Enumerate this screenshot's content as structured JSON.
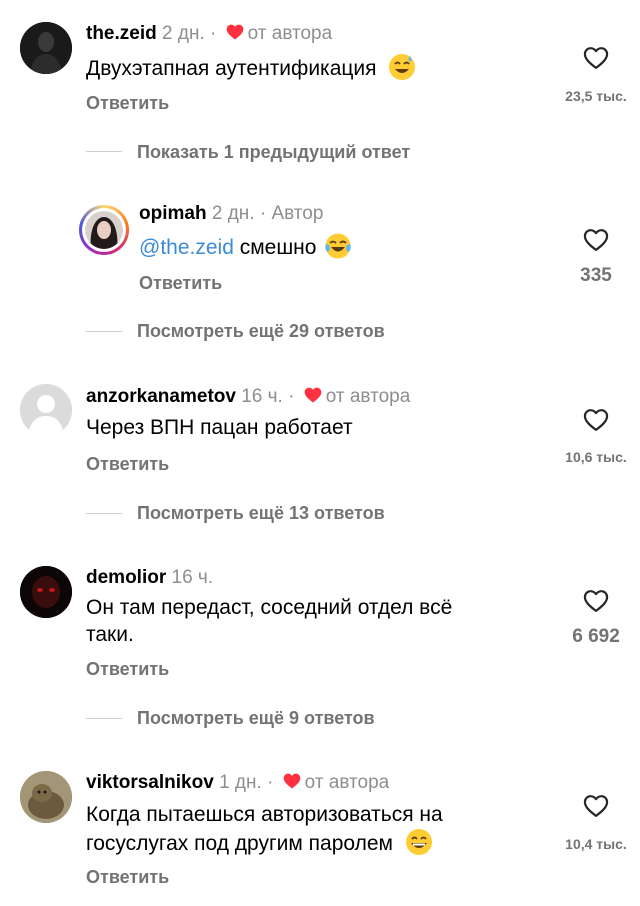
{
  "comments": [
    {
      "username": "the.zeid",
      "time": "2 дн.",
      "liked_by_author": "от автора",
      "text": "Двухэтапная аутентификация",
      "emoji": "sweat-smile-emoji",
      "reply_label": "Ответить",
      "likes": "23,5 тыс."
    },
    {
      "username": "anzorkanametov",
      "time": "16 ч.",
      "liked_by_author": "от автора",
      "text": "Через ВПН пацан работает",
      "reply_label": "Ответить",
      "likes": "10,6 тыс."
    },
    {
      "username": "demolior",
      "time": "16 ч.",
      "text_line1": "Он там передаст, соседний отдел всё",
      "text_line2": "таки.",
      "reply_label": "Ответить",
      "likes": "6 692"
    },
    {
      "username": "viktorsalnikov",
      "time": "1 дн.",
      "liked_by_author": "от автора",
      "text_line1": "Когда пытаешься авторизоваться на",
      "text_line2": "госуслугах под другим паролем",
      "emoji": "grinning-emoji",
      "reply_label": "Ответить",
      "likes": "10,4 тыс."
    }
  ],
  "reply": {
    "username": "opimah",
    "time": "2 дн.",
    "author_badge": "Автор",
    "mention": "@the.zeid",
    "text": " смешно",
    "emoji": "tears-of-joy-emoji",
    "reply_label": "Ответить",
    "likes": "335"
  },
  "threads": {
    "show_previous": "Показать 1 предыдущий ответ",
    "view_more_1": "Посмотреть ещё 29 ответов",
    "view_more_2": "Посмотреть ещё 13 ответов",
    "view_more_3": "Посмотреть ещё 9 ответов"
  },
  "colors": {
    "heart_red": "#ff3040",
    "mention_blue": "#3a8bd9",
    "story_ring": [
      "#feda75",
      "#fa7e1e",
      "#d62976",
      "#962fbf"
    ]
  },
  "separator": "·"
}
